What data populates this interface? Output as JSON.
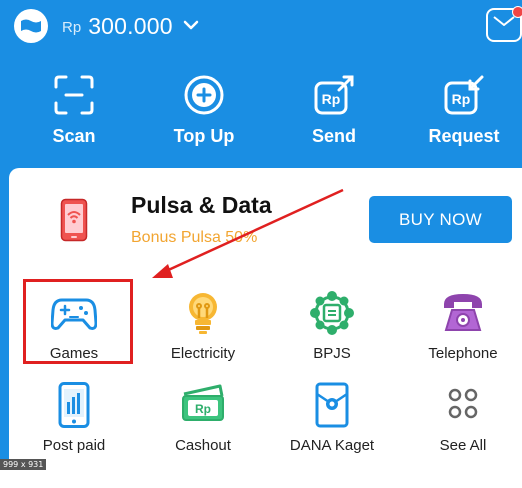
{
  "wallet": {
    "currency": "Rp",
    "amount": "300.000",
    "logo_icon": "wallet-flag-icon",
    "chevron_icon": "chevron-down-icon"
  },
  "inbox": {
    "icon": "mail-icon",
    "has_unread": true
  },
  "actions": [
    {
      "label": "Scan",
      "icon": "scan-icon"
    },
    {
      "label": "Top Up",
      "icon": "plus-circle-icon"
    },
    {
      "label": "Send",
      "icon": "send-money-icon"
    },
    {
      "label": "Request",
      "icon": "request-money-icon"
    }
  ],
  "promo": {
    "title": "Pulsa & Data",
    "subtitle": "Bonus Pulsa 50%",
    "button": "BUY NOW",
    "icon": "phone-wifi-icon"
  },
  "services": [
    {
      "label": "Games",
      "icon": "gamepad-icon"
    },
    {
      "label": "Electricity",
      "icon": "lightbulb-icon"
    },
    {
      "label": "BPJS",
      "icon": "bpjs-icon"
    },
    {
      "label": "Telephone",
      "icon": "telephone-icon"
    },
    {
      "label": "Post paid",
      "icon": "postpaid-phone-icon"
    },
    {
      "label": "Cashout",
      "icon": "cashout-icon"
    },
    {
      "label": "DANA Kaget",
      "icon": "dana-kaget-icon"
    },
    {
      "label": "See All",
      "icon": "grid-dots-icon"
    }
  ],
  "dimension_caption": "999 x 931",
  "colors": {
    "primary": "#1a8ee3",
    "promo_accent": "#f2a531",
    "annotation": "#e02020"
  }
}
